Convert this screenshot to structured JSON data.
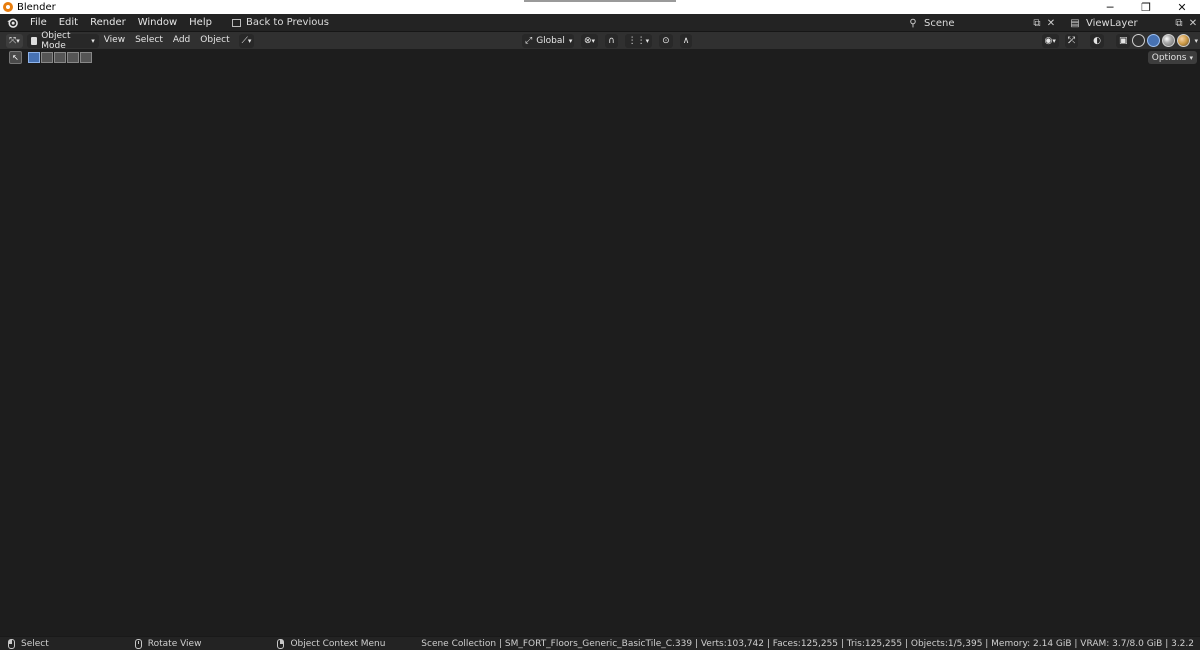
{
  "window": {
    "title": "Blender",
    "minimize": "─",
    "maximize": "❐",
    "close": "✕"
  },
  "menu": {
    "items": [
      "File",
      "Edit",
      "Render",
      "Window",
      "Help"
    ],
    "back_label": "Back to Previous"
  },
  "scene": {
    "name": "Scene",
    "view_layer": "ViewLayer"
  },
  "viewport_header": {
    "mode": "Object Mode",
    "menus": [
      "View",
      "Select",
      "Add",
      "Object"
    ],
    "orientation": "Global",
    "shading_active": "solid"
  },
  "toolbar": {
    "options_label": "Options"
  },
  "status": {
    "hints": [
      {
        "mouse": "l",
        "label": "Select"
      },
      {
        "mouse": "m",
        "label": "Rotate View"
      },
      {
        "mouse": "r",
        "label": "Object Context Menu"
      }
    ],
    "stats": "Scene Collection | SM_FORT_Floors_Generic_BasicTile_C.339 | Verts:103,742 | Faces:125,255 | Tris:125,255 | Objects:1/5,395 | Memory: 2.14 GiB | VRAM: 3.7/8.0 GiB | 3.2.2"
  },
  "colors": {
    "accent": "#4772b3",
    "viewport_bg": "#3a3f48",
    "mesh": "#8c8c8c"
  }
}
